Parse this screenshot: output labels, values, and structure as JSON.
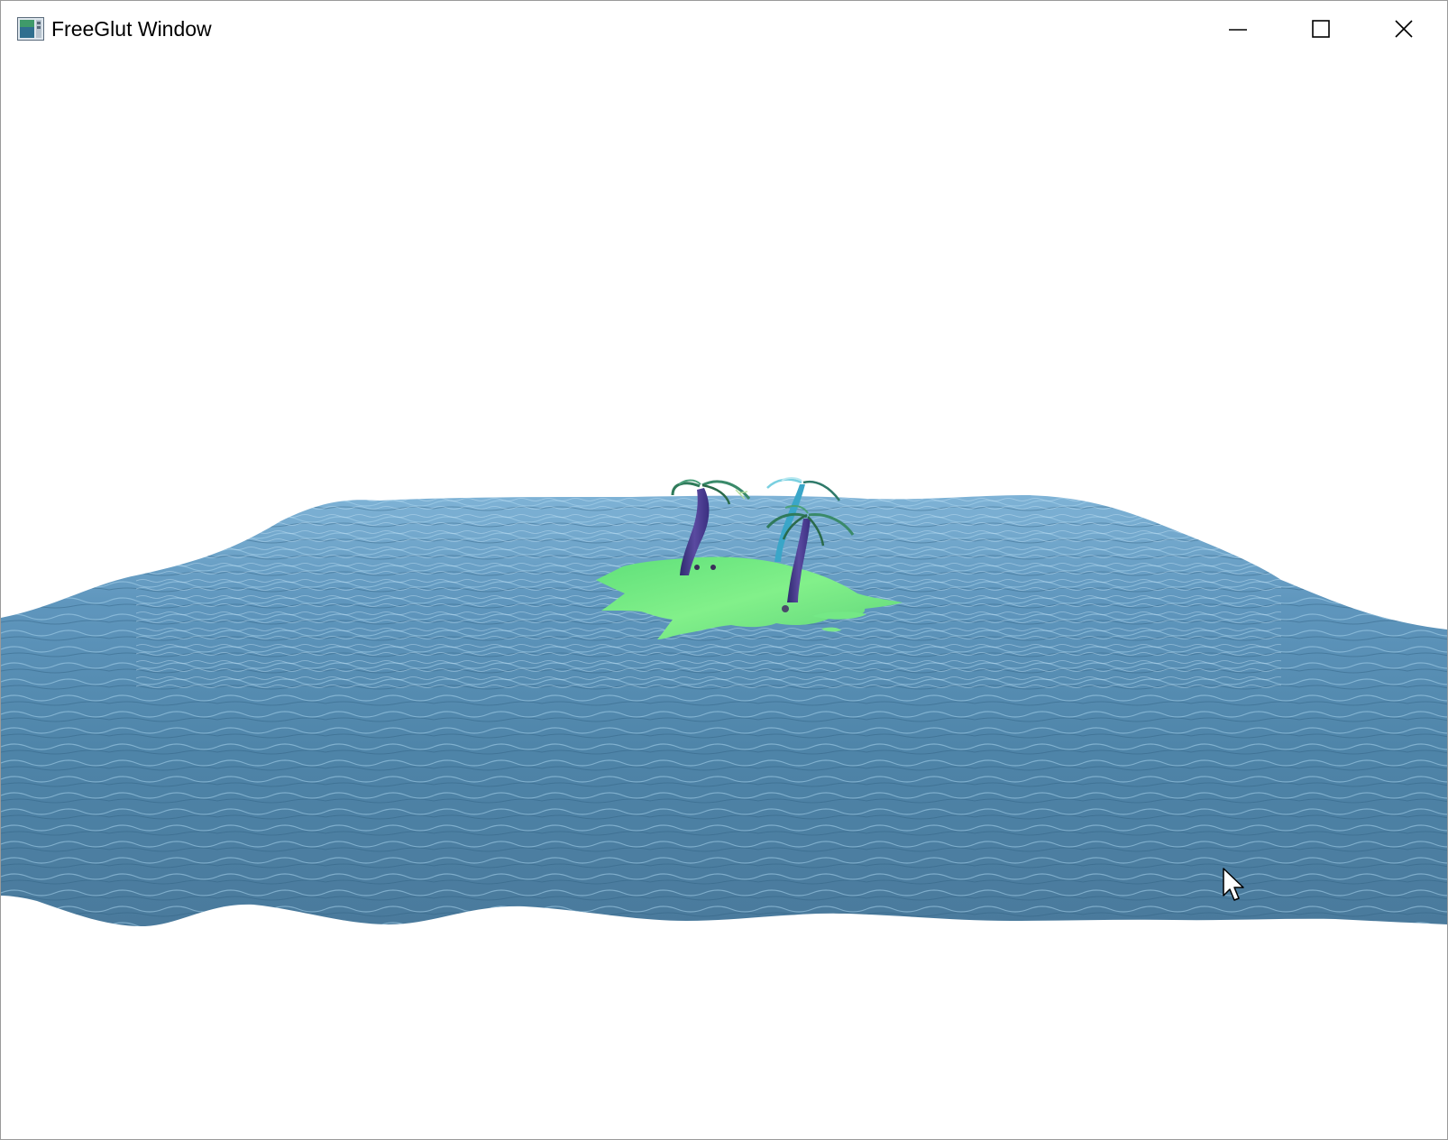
{
  "window": {
    "title": "FreeGlut Window",
    "app_icon": "opengl-app-icon",
    "controls": {
      "minimize_icon": "minimize-icon",
      "maximize_icon": "maximize-icon",
      "close_icon": "close-icon"
    }
  },
  "scene": {
    "sky_color": "#ffffff",
    "water_color": "#4a7fa3",
    "water_highlight": "#8fbfdc",
    "island_color": "#6fe87a",
    "palm_trunk_color": "#4a3a8a",
    "palm_leaf_color": "#2f8a6a"
  },
  "pointer": {
    "icon": "mouse-pointer-icon"
  }
}
